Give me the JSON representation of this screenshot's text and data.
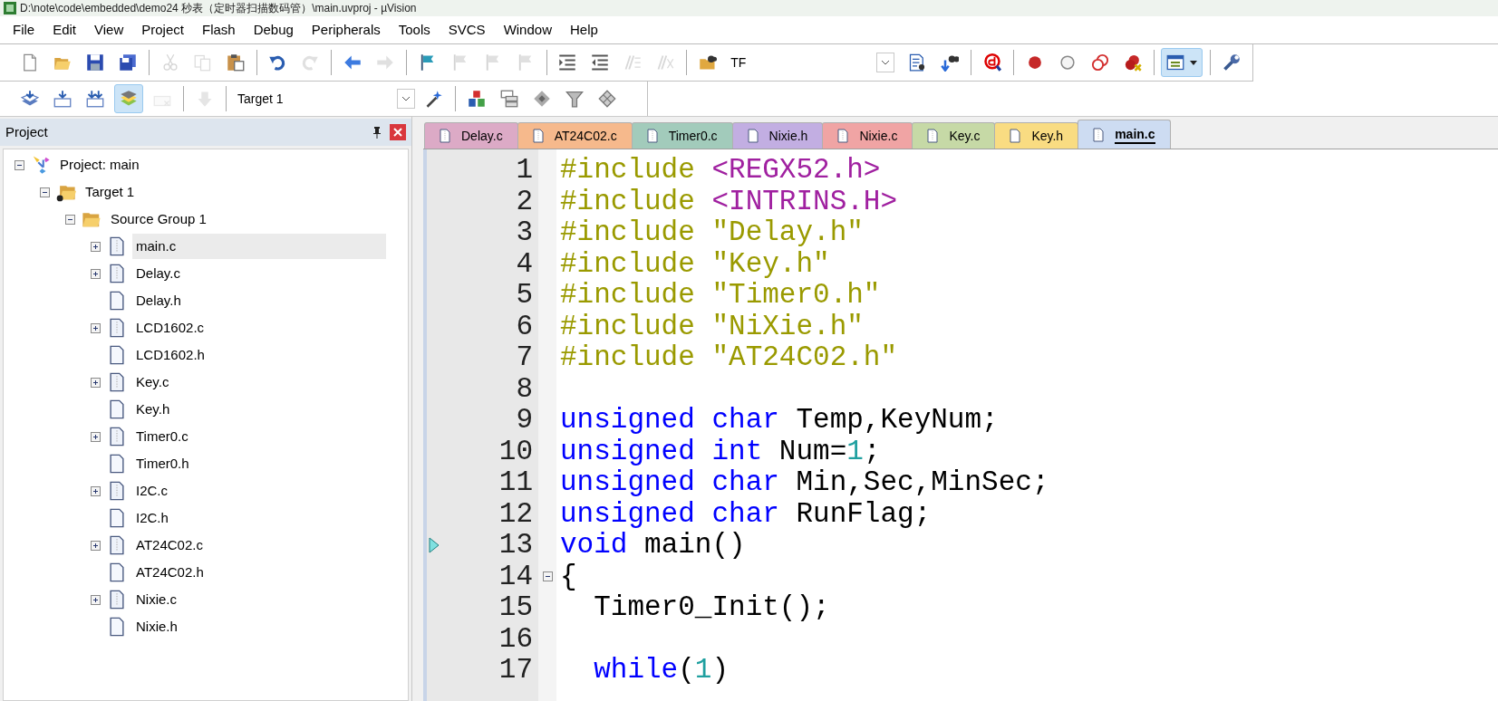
{
  "window": {
    "title": "D:\\note\\code\\embedded\\demo24 秒表（定时器扫描数码管）\\main.uvproj - µVision"
  },
  "menu": [
    "File",
    "Edit",
    "View",
    "Project",
    "Flash",
    "Debug",
    "Peripherals",
    "Tools",
    "SVCS",
    "Window",
    "Help"
  ],
  "toolbar_1": [
    {
      "kind": "new",
      "disabled": false,
      "pressed": false
    },
    {
      "kind": "open",
      "disabled": false,
      "pressed": false
    },
    {
      "kind": "save",
      "disabled": false,
      "pressed": false
    },
    {
      "kind": "save-all",
      "disabled": false,
      "pressed": false
    },
    {
      "kind": "separator"
    },
    {
      "kind": "cut",
      "disabled": true,
      "pressed": false
    },
    {
      "kind": "copy",
      "disabled": true,
      "pressed": false
    },
    {
      "kind": "paste",
      "disabled": false,
      "pressed": false
    },
    {
      "kind": "separator"
    },
    {
      "kind": "undo",
      "disabled": false,
      "pressed": false
    },
    {
      "kind": "redo",
      "disabled": true,
      "pressed": false
    },
    {
      "kind": "separator"
    },
    {
      "kind": "back",
      "disabled": false,
      "pressed": false
    },
    {
      "kind": "forward",
      "disabled": true,
      "pressed": false
    },
    {
      "kind": "separator"
    },
    {
      "kind": "bookmark",
      "disabled": false,
      "pressed": false
    },
    {
      "kind": "bookmark",
      "disabled": true,
      "pressed": false
    },
    {
      "kind": "bookmark",
      "disabled": true,
      "pressed": false
    },
    {
      "kind": "bookmark",
      "disabled": true,
      "pressed": false
    },
    {
      "kind": "separator"
    },
    {
      "kind": "indent",
      "disabled": false,
      "pressed": false
    },
    {
      "kind": "unindent",
      "disabled": false,
      "pressed": false
    },
    {
      "kind": "comment",
      "disabled": true,
      "pressed": false
    },
    {
      "kind": "uncomment",
      "disabled": true,
      "pressed": false
    },
    {
      "kind": "separator"
    },
    {
      "kind": "find-files",
      "disabled": false,
      "pressed": false
    },
    {
      "kind": "find-combo",
      "value": "TF"
    },
    {
      "kind": "find",
      "disabled": false,
      "pressed": false
    },
    {
      "kind": "incremental-find",
      "disabled": false,
      "pressed": false
    },
    {
      "kind": "separator"
    },
    {
      "kind": "debug",
      "disabled": false,
      "pressed": false
    },
    {
      "kind": "separator"
    },
    {
      "kind": "breakpoint",
      "disabled": false,
      "pressed": false
    },
    {
      "kind": "breakpoint-toggle",
      "disabled": false,
      "pressed": false
    },
    {
      "kind": "breakpoint-disable-all",
      "disabled": false,
      "pressed": false
    },
    {
      "kind": "breakpoint-kill",
      "disabled": false,
      "pressed": false
    },
    {
      "kind": "separator"
    },
    {
      "kind": "window-layout",
      "disabled": false,
      "pressed": true
    },
    {
      "kind": "separator"
    },
    {
      "kind": "configure",
      "disabled": false,
      "pressed": false
    }
  ],
  "toolbar_2": [
    {
      "kind": "translate",
      "disabled": false,
      "pressed": false
    },
    {
      "kind": "build",
      "disabled": false,
      "pressed": false
    },
    {
      "kind": "rebuild",
      "disabled": false,
      "pressed": false
    },
    {
      "kind": "batch-build",
      "disabled": false,
      "pressed": true
    },
    {
      "kind": "stop-build",
      "disabled": true,
      "pressed": false
    },
    {
      "kind": "separator"
    },
    {
      "kind": "download",
      "disabled": true,
      "pressed": false
    },
    {
      "kind": "separator"
    },
    {
      "kind": "target-select",
      "value": "Target 1"
    },
    {
      "kind": "options",
      "disabled": false,
      "pressed": false
    },
    {
      "kind": "separator"
    },
    {
      "kind": "components",
      "disabled": false,
      "pressed": false
    },
    {
      "kind": "windows",
      "disabled": false,
      "pressed": false
    },
    {
      "kind": "diamond",
      "disabled": false,
      "pressed": false
    },
    {
      "kind": "funnel",
      "disabled": false,
      "pressed": false
    },
    {
      "kind": "grid-diamond",
      "disabled": false,
      "pressed": false
    }
  ],
  "project_panel": {
    "title": "Project",
    "tree": [
      {
        "kind": "project",
        "label": "Project: main",
        "expanded": true,
        "selected": false,
        "children": [
          {
            "kind": "target",
            "label": "Target 1",
            "expanded": true,
            "selected": false,
            "children": [
              {
                "kind": "group",
                "label": "Source Group 1",
                "expanded": true,
                "selected": false,
                "children": [
                  {
                    "kind": "c-file",
                    "label": "main.c",
                    "expanded": false,
                    "selected": true
                  },
                  {
                    "kind": "c-file",
                    "label": "Delay.c",
                    "expanded": false,
                    "selected": false
                  },
                  {
                    "kind": "h-file",
                    "label": "Delay.h",
                    "selected": false
                  },
                  {
                    "kind": "c-file",
                    "label": "LCD1602.c",
                    "expanded": false,
                    "selected": false
                  },
                  {
                    "kind": "h-file",
                    "label": "LCD1602.h",
                    "selected": false
                  },
                  {
                    "kind": "c-file",
                    "label": "Key.c",
                    "expanded": false,
                    "selected": false
                  },
                  {
                    "kind": "h-file",
                    "label": "Key.h",
                    "selected": false
                  },
                  {
                    "kind": "c-file",
                    "label": "Timer0.c",
                    "expanded": false,
                    "selected": false
                  },
                  {
                    "kind": "h-file",
                    "label": "Timer0.h",
                    "selected": false
                  },
                  {
                    "kind": "c-file",
                    "label": "I2C.c",
                    "expanded": false,
                    "selected": false
                  },
                  {
                    "kind": "h-file",
                    "label": "I2C.h",
                    "selected": false
                  },
                  {
                    "kind": "c-file",
                    "label": "AT24C02.c",
                    "expanded": false,
                    "selected": false
                  },
                  {
                    "kind": "h-file",
                    "label": "AT24C02.h",
                    "selected": false
                  },
                  {
                    "kind": "c-file",
                    "label": "Nixie.c",
                    "expanded": false,
                    "selected": false
                  },
                  {
                    "kind": "h-file",
                    "label": "Nixie.h",
                    "selected": false
                  }
                ]
              }
            ]
          }
        ]
      }
    ]
  },
  "editor": {
    "tabs": [
      {
        "label": "Delay.c",
        "kind": "c",
        "color": "#dcaac6",
        "selected": false
      },
      {
        "label": "AT24C02.c",
        "kind": "c",
        "color": "#f6b98c",
        "selected": false
      },
      {
        "label": "Timer0.c",
        "kind": "c",
        "color": "#a2cbbb",
        "selected": false
      },
      {
        "label": "Nixie.h",
        "kind": "h",
        "color": "#c2aee2",
        "selected": false
      },
      {
        "label": "Nixie.c",
        "kind": "c",
        "color": "#f0a4a4",
        "selected": false
      },
      {
        "label": "Key.c",
        "kind": "c",
        "color": "#c6d9a6",
        "selected": false
      },
      {
        "label": "Key.h",
        "kind": "h",
        "color": "#f9dc82",
        "selected": false
      },
      {
        "label": "main.c",
        "kind": "c",
        "color": "#cddcf2",
        "selected": true
      }
    ],
    "lines": [
      {
        "number": "1",
        "tokens": [
          {
            "kind": "directive",
            "text": "#include "
          },
          {
            "kind": "header",
            "text": "<REGX52.h>"
          }
        ]
      },
      {
        "number": "2",
        "tokens": [
          {
            "kind": "directive",
            "text": "#include "
          },
          {
            "kind": "header",
            "text": "<INTRINS.H>"
          }
        ]
      },
      {
        "number": "3",
        "tokens": [
          {
            "kind": "directive",
            "text": "#include "
          },
          {
            "kind": "string",
            "text": "\"Delay.h\""
          }
        ]
      },
      {
        "number": "4",
        "tokens": [
          {
            "kind": "directive",
            "text": "#include "
          },
          {
            "kind": "string",
            "text": "\"Key.h\""
          }
        ]
      },
      {
        "number": "5",
        "tokens": [
          {
            "kind": "directive",
            "text": "#include "
          },
          {
            "kind": "string",
            "text": "\"Timer0.h\""
          }
        ]
      },
      {
        "number": "6",
        "tokens": [
          {
            "kind": "directive",
            "text": "#include "
          },
          {
            "kind": "string",
            "text": "\"NiXie.h\""
          }
        ]
      },
      {
        "number": "7",
        "tokens": [
          {
            "kind": "directive",
            "text": "#include "
          },
          {
            "kind": "string",
            "text": "\"AT24C02.h\""
          }
        ]
      },
      {
        "number": "8"
      },
      {
        "number": "9",
        "tokens": [
          {
            "kind": "keyword",
            "text": "unsigned char"
          },
          {
            "kind": "plain",
            "text": " Temp,KeyNum;"
          }
        ]
      },
      {
        "number": "10",
        "tokens": [
          {
            "kind": "keyword",
            "text": "unsigned int"
          },
          {
            "kind": "plain",
            "text": " Num="
          },
          {
            "kind": "number",
            "text": "1"
          },
          {
            "kind": "plain",
            "text": ";"
          }
        ]
      },
      {
        "number": "11",
        "tokens": [
          {
            "kind": "keyword",
            "text": "unsigned char"
          },
          {
            "kind": "plain",
            "text": " Min,Sec,MinSec;"
          }
        ]
      },
      {
        "number": "12",
        "tokens": [
          {
            "kind": "keyword",
            "text": "unsigned char"
          },
          {
            "kind": "plain",
            "text": " RunFlag;"
          }
        ]
      },
      {
        "number": "13",
        "current": true,
        "tokens": [
          {
            "kind": "keyword",
            "text": "void"
          },
          {
            "kind": "plain",
            "text": " main()"
          }
        ]
      },
      {
        "number": "14",
        "fold": true,
        "tokens": [
          {
            "kind": "plain",
            "text": "{"
          }
        ]
      },
      {
        "number": "15",
        "tokens": [
          {
            "kind": "plain",
            "text": "  Timer0_Init();"
          }
        ]
      },
      {
        "number": "16"
      },
      {
        "number": "17",
        "tokens": [
          {
            "kind": "keyword",
            "text": "  while"
          },
          {
            "kind": "plain",
            "text": "("
          },
          {
            "kind": "number",
            "text": "1"
          },
          {
            "kind": "plain",
            "text": ")"
          }
        ]
      }
    ]
  }
}
